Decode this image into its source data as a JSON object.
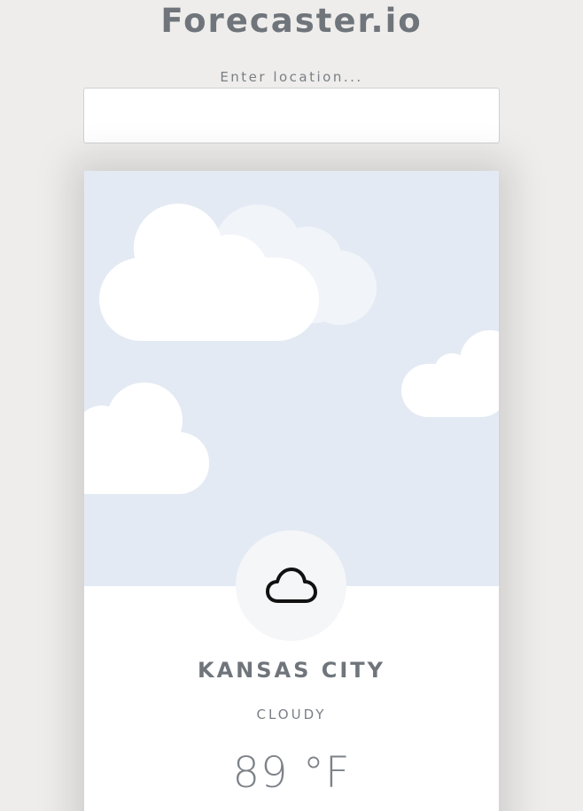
{
  "app": {
    "title": "Forecaster.io"
  },
  "search": {
    "label": "Enter location...",
    "value": "",
    "placeholder": ""
  },
  "weather": {
    "city": "KANSAS CITY",
    "condition": "CLOUDY",
    "temperature": "89 °F",
    "icon": "cloud-icon"
  },
  "colors": {
    "background": "#eeedeb",
    "sky": "#e4eaf4",
    "text": "#6f757b"
  }
}
